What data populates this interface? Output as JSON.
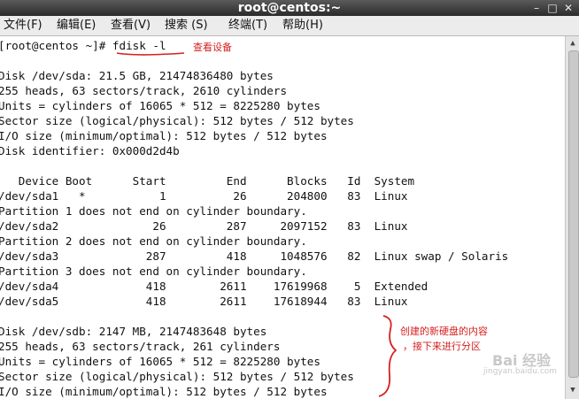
{
  "window": {
    "title": "root@centos:~",
    "minimize_glyph": "–",
    "maximize_glyph": "□",
    "close_glyph": "✕"
  },
  "menu": [
    "文件(F)",
    "编辑(E)",
    "查看(V)",
    "搜索 (S)",
    "终端(T)",
    "帮助(H)"
  ],
  "terminal": {
    "prompt": "[root@centos ~]# ",
    "command": "fdisk -l",
    "lines": [
      "",
      "Disk /dev/sda: 21.5 GB, 21474836480 bytes",
      "255 heads, 63 sectors/track, 2610 cylinders",
      "Units = cylinders of 16065 * 512 = 8225280 bytes",
      "Sector size (logical/physical): 512 bytes / 512 bytes",
      "I/O size (minimum/optimal): 512 bytes / 512 bytes",
      "Disk identifier: 0x000d2d4b",
      "",
      "   Device Boot      Start         End      Blocks   Id  System",
      "/dev/sda1   *           1          26      204800   83  Linux",
      "Partition 1 does not end on cylinder boundary.",
      "/dev/sda2              26         287     2097152   83  Linux",
      "Partition 2 does not end on cylinder boundary.",
      "/dev/sda3             287         418     1048576   82  Linux swap / Solaris",
      "Partition 3 does not end on cylinder boundary.",
      "/dev/sda4             418        2611    17619968    5  Extended",
      "/dev/sda5             418        2611    17618944   83  Linux",
      "",
      "Disk /dev/sdb: 2147 MB, 2147483648 bytes",
      "255 heads, 63 sectors/track, 261 cylinders",
      "Units = cylinders of 16065 * 512 = 8225280 bytes",
      "Sector size (logical/physical): 512 bytes / 512 bytes",
      "I/O size (minimum/optimal): 512 bytes / 512 bytes"
    ]
  },
  "annotations": {
    "command_note": "查看设备",
    "new_disk_note_1": "创建的新硬盘的内容",
    "new_disk_note_2": "，接下来进行分区",
    "color": "#d62020"
  },
  "watermark": {
    "brand": "Bai 经验",
    "url": "jingyan.baidu.com"
  }
}
